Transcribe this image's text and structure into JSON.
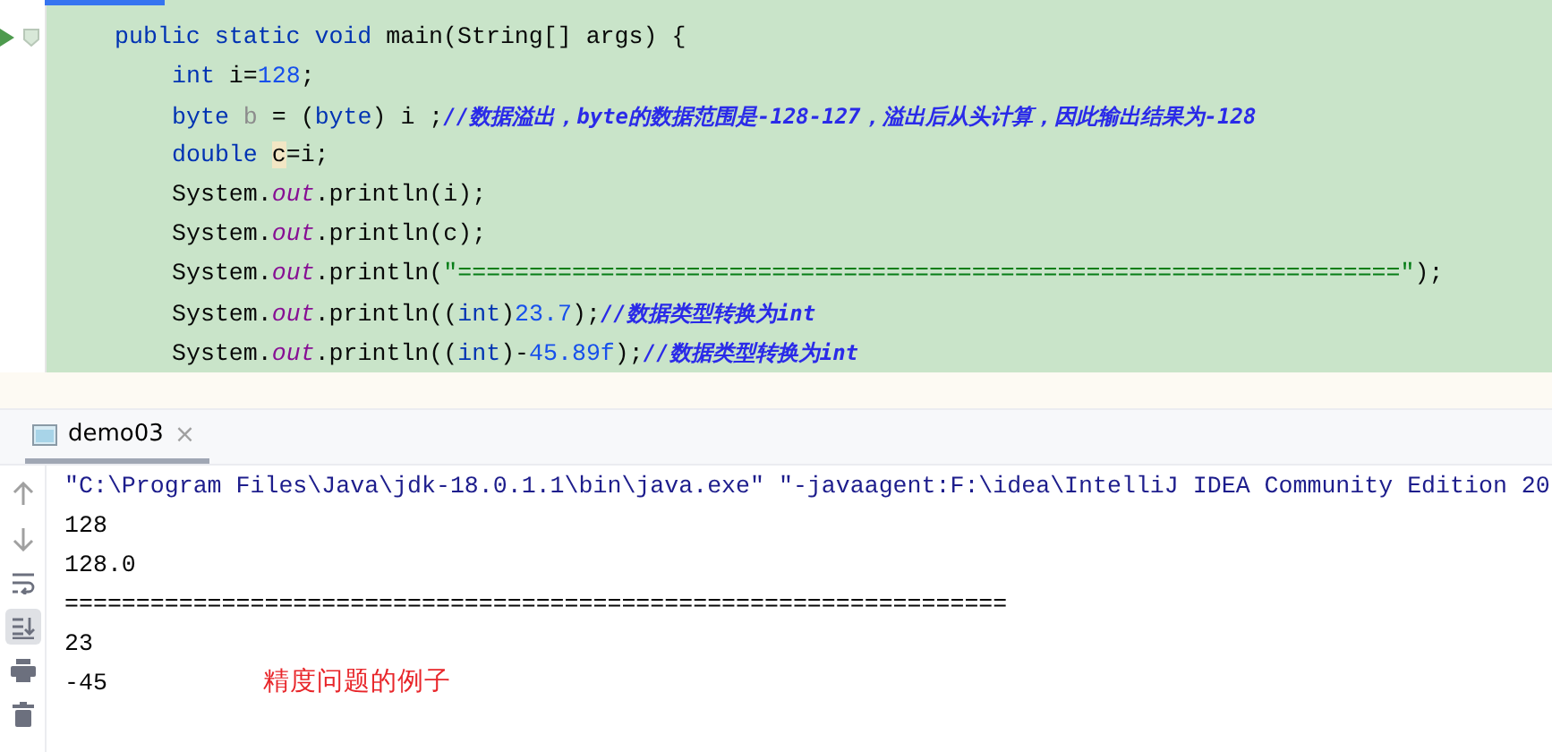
{
  "editor": {
    "method": {
      "tokens": [
        {
          "kind": "keyword",
          "text": "public static void "
        },
        {
          "kind": "plain",
          "text": "main(String[] args) {"
        }
      ],
      "body": [
        {
          "tokens": [
            {
              "kind": "keyword",
              "text": "int "
            },
            {
              "kind": "plain",
              "text": "i="
            },
            {
              "kind": "number",
              "text": "128"
            },
            {
              "kind": "plain",
              "text": ";"
            }
          ]
        },
        {
          "tokens": [
            {
              "kind": "keyword",
              "text": "byte "
            },
            {
              "kind": "unused",
              "text": "b"
            },
            {
              "kind": "plain",
              "text": " = ("
            },
            {
              "kind": "keyword",
              "text": "byte"
            },
            {
              "kind": "plain",
              "text": ") i ;"
            },
            {
              "kind": "comment",
              "text": "//数据溢出，byte的数据范围是-128-127，溢出后从头计算，因此输出结果为-128"
            }
          ]
        },
        {
          "tokens": [
            {
              "kind": "keyword",
              "text": "double "
            },
            {
              "kind": "usage",
              "text": "c"
            },
            {
              "kind": "plain",
              "text": "=i;"
            }
          ]
        },
        {
          "tokens": [
            {
              "kind": "plain",
              "text": "System."
            },
            {
              "kind": "field",
              "text": "out"
            },
            {
              "kind": "plain",
              "text": ".println(i);"
            }
          ]
        },
        {
          "tokens": [
            {
              "kind": "plain",
              "text": "System."
            },
            {
              "kind": "field",
              "text": "out"
            },
            {
              "kind": "plain",
              "text": ".println(c);"
            }
          ]
        },
        {
          "tokens": [
            {
              "kind": "plain",
              "text": "System."
            },
            {
              "kind": "field",
              "text": "out"
            },
            {
              "kind": "plain",
              "text": ".println("
            },
            {
              "kind": "string",
              "text": "\"==================================================================\""
            },
            {
              "kind": "plain",
              "text": ");"
            }
          ]
        },
        {
          "tokens": [
            {
              "kind": "plain",
              "text": "System."
            },
            {
              "kind": "field",
              "text": "out"
            },
            {
              "kind": "plain",
              "text": ".println(("
            },
            {
              "kind": "keyword",
              "text": "int"
            },
            {
              "kind": "plain",
              "text": ")"
            },
            {
              "kind": "number",
              "text": "23.7"
            },
            {
              "kind": "plain",
              "text": ");"
            },
            {
              "kind": "comment",
              "text": "//数据类型转换为int"
            }
          ]
        },
        {
          "tokens": [
            {
              "kind": "plain",
              "text": "System."
            },
            {
              "kind": "field",
              "text": "out"
            },
            {
              "kind": "plain",
              "text": ".println(("
            },
            {
              "kind": "keyword",
              "text": "int"
            },
            {
              "kind": "plain",
              "text": ")-"
            },
            {
              "kind": "number",
              "text": "45.89f"
            },
            {
              "kind": "plain",
              "text": ");"
            },
            {
              "kind": "comment",
              "text": "//数据类型转换为int"
            }
          ]
        }
      ]
    }
  },
  "run_panel": {
    "tab": {
      "label": "demo03",
      "close": "×",
      "selected": true
    },
    "output": [
      {
        "kind": "command",
        "text": "\"C:\\Program Files\\Java\\jdk-18.0.1.1\\bin\\java.exe\" \"-javaagent:F:\\idea\\IntelliJ IDEA Community Edition 20"
      },
      {
        "kind": "stdout",
        "text": "128"
      },
      {
        "kind": "stdout",
        "text": "128.0"
      },
      {
        "kind": "stdout",
        "text": "=================================================================="
      },
      {
        "kind": "stdout",
        "text": "23"
      },
      {
        "kind": "stdout",
        "text": "-45"
      }
    ],
    "annotation": "精度问题的例子"
  }
}
